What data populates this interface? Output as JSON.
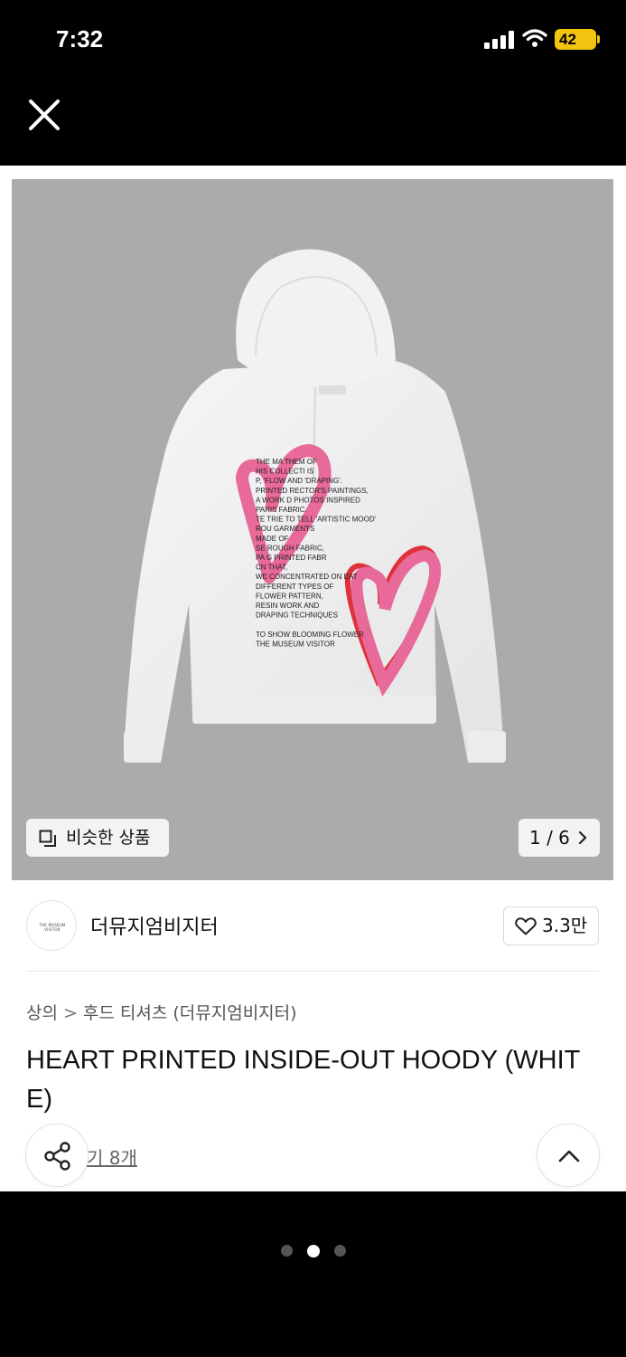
{
  "status_bar": {
    "time": "7:32",
    "battery": "42"
  },
  "top_bar": {
    "close_icon": "close-icon"
  },
  "gallery": {
    "print_lines": [
      "THE MA    THEM   OF",
      "HIS  COLLECTI   IS",
      "   P,  'FLOW   AND 'DRAPING'.",
      "    PRINTED   RECTOR'S PAINTINGS,",
      "A   WORK   D PHOTOS INSPIRED",
      "    PARIS   FABRIC.",
      "TE TRIE   TO TELL 'ARTISTIC MOOD'",
      "   ROU   GARMENTS",
      "   MADE OF",
      "SE   ROUGH FABRIC,",
      "PA    G PRINTED FABR",
      "       CN   THAT,",
      "WE CONCENTRATED ON    EAT",
      "DIFFERENT TYPES OF",
      "FLOWER PATTERN,",
      "RESIN WORK AND",
      "DRAPING TECHNIQUES",
      "",
      "TO SHOW BLOOMING FLOWER",
      "THE MUSEUM VISITOR"
    ],
    "similar_label": "비슷한 상품",
    "page_indicator": "1 / 6"
  },
  "brand": {
    "logo_text": "THE MUSEUM VISITOR",
    "name": "더뮤지엄비지터",
    "likes": "3.3만"
  },
  "breadcrumb": {
    "category": "상의",
    "subcategory": "후드 티셔츠 (더뮤지엄비지터)"
  },
  "product": {
    "title": "HEART PRINTED INSIDE-OUT HOODY (WHITE)",
    "review_link": "기 8개"
  },
  "colors": {
    "image_bg": "#ababab",
    "heart_pink": "#e86a9a",
    "heart_red": "#e0303a",
    "battery": "#f1c40f"
  },
  "pagination": {
    "count": 3,
    "active_index": 1
  }
}
